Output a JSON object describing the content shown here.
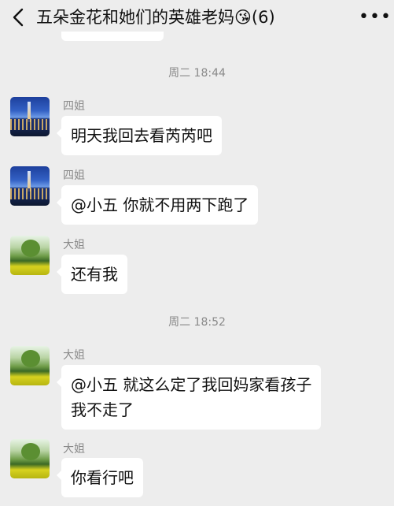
{
  "header": {
    "title": "五朵金花和她们的英雄老妈😘(6)",
    "back_icon": "chevron-left-icon",
    "more_label": "•••"
  },
  "messages": [
    {
      "type": "time",
      "text": "周二 18:44"
    },
    {
      "type": "msg",
      "sender": "四姐",
      "avatar": "city-night-avatar",
      "lines": [
        "明天我回去看芮芮吧"
      ]
    },
    {
      "type": "msg",
      "sender": "四姐",
      "avatar": "city-night-avatar",
      "lines": [
        "@小五  你就不用两下跑了"
      ]
    },
    {
      "type": "msg",
      "sender": "大姐",
      "avatar": "green-field-avatar",
      "lines": [
        "还有我"
      ]
    },
    {
      "type": "time",
      "text": "周二 18:52"
    },
    {
      "type": "msg",
      "sender": "大姐",
      "avatar": "green-field-avatar",
      "lines": [
        "@小五  就这么定了我回妈家看孩子",
        "我不走了"
      ]
    },
    {
      "type": "msg",
      "sender": "大姐",
      "avatar": "green-field-avatar",
      "lines": [
        "你看行吧"
      ]
    }
  ]
}
